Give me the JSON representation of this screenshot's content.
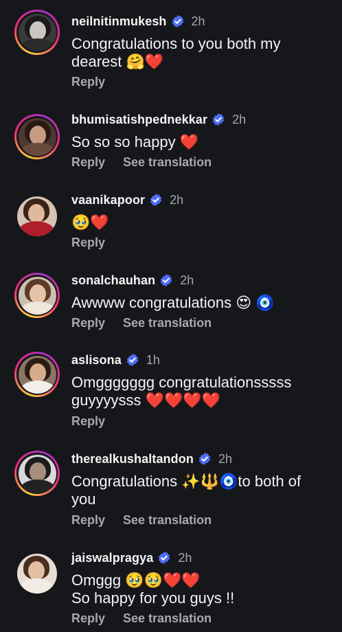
{
  "colors": {
    "background": "#16171b",
    "verified": "#4f6ef7",
    "muted": "#a8a9ae",
    "text": "#f3f4f6",
    "heart": "#ee1d2d"
  },
  "comments": [
    {
      "username": "neilnitinmukesh",
      "time": "2h",
      "text": "Congratulations to you both my\ndearest 🤗❤️",
      "reply": "Reply",
      "translation": ""
    },
    {
      "username": "bhumisatishpednekkar",
      "time": "2h",
      "text": "So so so happy ❤️",
      "reply": "Reply",
      "translation": "See translation"
    },
    {
      "username": "vaanikapoor",
      "time": "2h",
      "text": "🥹❤️",
      "reply": "Reply",
      "translation": ""
    },
    {
      "username": "sonalchauhan",
      "time": "2h",
      "text": "Awwww congratulations 😍 🧿",
      "reply": "Reply",
      "translation": "See translation"
    },
    {
      "username": "aslisona",
      "time": "1h",
      "text": "Omggggggg congratulationsssss\nguyyyysss ❤️❤️❤️❤️",
      "reply": "Reply",
      "translation": ""
    },
    {
      "username": "therealkushaltandon",
      "time": "2h",
      "text": "Congratulations ✨🔱🧿to both of\nyou",
      "reply": "Reply",
      "translation": "See translation"
    },
    {
      "username": "jaiswalpragya",
      "time": "2h",
      "text": "Omggg 🥹🥹❤️❤️\nSo happy for you guys !!",
      "reply": "Reply",
      "translation": "See translation"
    }
  ]
}
